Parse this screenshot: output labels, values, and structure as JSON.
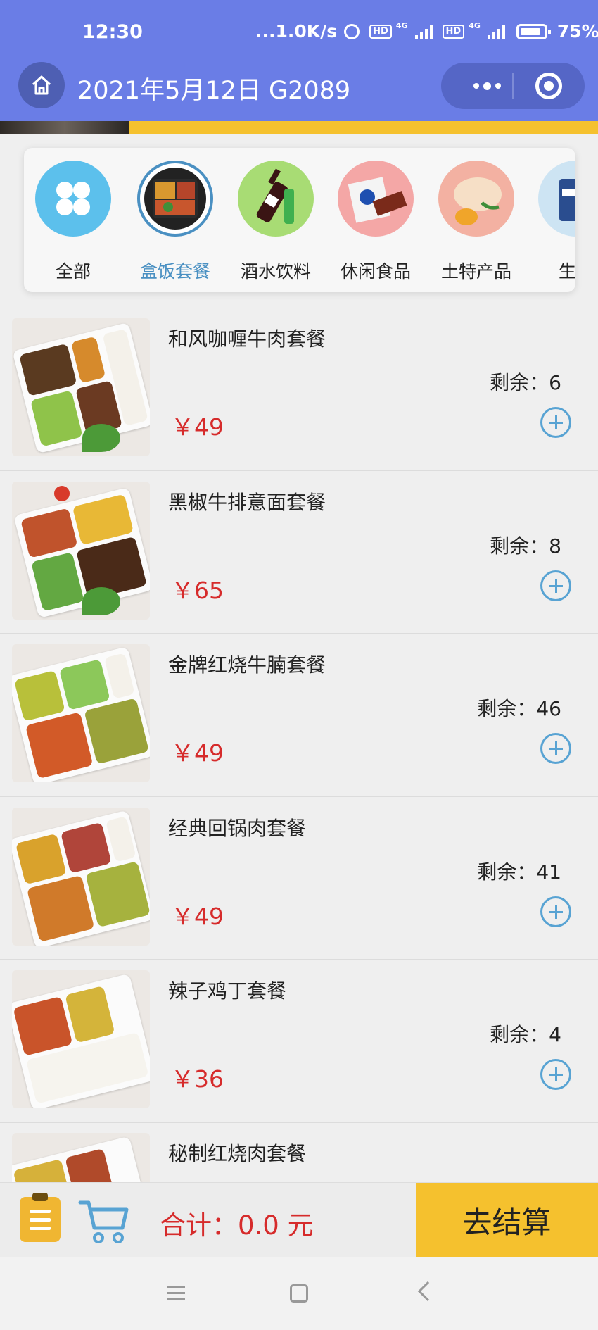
{
  "status_bar": {
    "time": "12:30",
    "network": "...1.0K/s",
    "network_type_1": "4G",
    "network_type_2": "4G",
    "hd_1": "HD",
    "hd_2": "HD",
    "battery": "75%"
  },
  "nav": {
    "title": "2021年5月12日 G2089"
  },
  "categories": [
    {
      "label": "全部",
      "active": false
    },
    {
      "label": "盒饭套餐",
      "active": true
    },
    {
      "label": "酒水饮料",
      "active": false
    },
    {
      "label": "休闲食品",
      "active": false
    },
    {
      "label": "土特产品",
      "active": false
    },
    {
      "label": "生活",
      "active": false
    }
  ],
  "products": [
    {
      "name": "和风咖喱牛肉套餐",
      "stock": "剩余：6",
      "price": "￥49"
    },
    {
      "name": "黑椒牛排意面套餐",
      "stock": "剩余：8",
      "price": "￥65"
    },
    {
      "name": "金牌红烧牛腩套餐",
      "stock": "剩余：46",
      "price": "￥49"
    },
    {
      "name": "经典回锅肉套餐",
      "stock": "剩余：41",
      "price": "￥49"
    },
    {
      "name": "辣子鸡丁套餐",
      "stock": "剩余：4",
      "price": "￥36"
    },
    {
      "name": "秘制红烧肉套餐",
      "stock": "",
      "price": ""
    }
  ],
  "cart": {
    "total": "合计：0.0 元",
    "checkout_label": "去结算"
  },
  "colors": {
    "header": "#6a7de6",
    "accent_yellow": "#f5c12e",
    "price_red": "#d62b2b",
    "active_blue": "#4a90c2"
  }
}
